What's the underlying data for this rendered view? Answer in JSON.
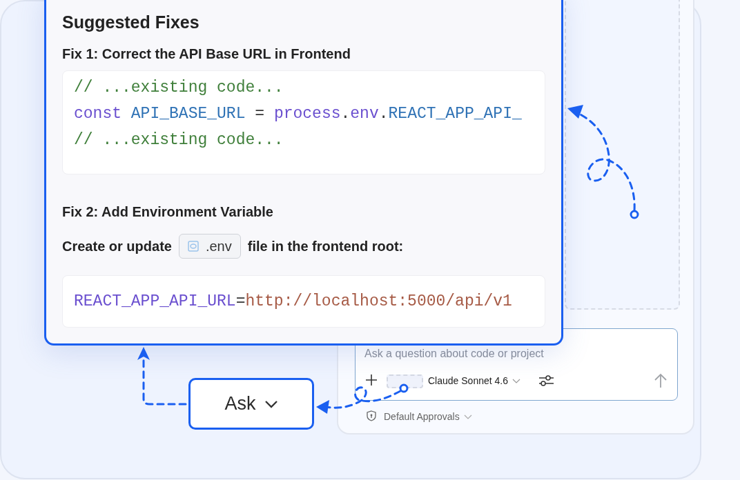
{
  "fixes_card": {
    "title": "Suggested Fixes",
    "fix_1": {
      "heading": "Fix 1: Correct the API Base URL in Frontend",
      "code": [
        [
          {
            "kind": "comment",
            "text": "// ...existing code..."
          }
        ],
        [
          {
            "kind": "keyword",
            "text": "const"
          },
          {
            "kind": "variable",
            "text": " API_BASE_URL"
          },
          {
            "kind": "plain",
            "text": " = "
          },
          {
            "kind": "keyword",
            "text": "process"
          },
          {
            "kind": "plain",
            "text": "."
          },
          {
            "kind": "keyword",
            "text": "env"
          },
          {
            "kind": "plain",
            "text": "."
          },
          {
            "kind": "variable",
            "text": "REACT_APP_API_"
          }
        ],
        [
          {
            "kind": "comment",
            "text": "// ...existing code..."
          }
        ]
      ]
    },
    "fix_2": {
      "heading": "Fix 2: Add Environment Variable",
      "text_before": "Create or update",
      "file_chip": ".env",
      "text_after": "file in the frontend root:",
      "code": [
        [
          {
            "kind": "keyword",
            "text": "REACT_APP_API_URL"
          },
          {
            "kind": "plain",
            "text": "="
          },
          {
            "kind": "string",
            "text": "http://localhost:5000/api/v1"
          }
        ]
      ]
    }
  },
  "chat_panel": {
    "input": {
      "placeholder": "Ask a question about code or project"
    },
    "model": "Claude Sonnet 4.6",
    "approvals": "Default Approvals"
  },
  "mode_button": {
    "label": "Ask"
  }
}
